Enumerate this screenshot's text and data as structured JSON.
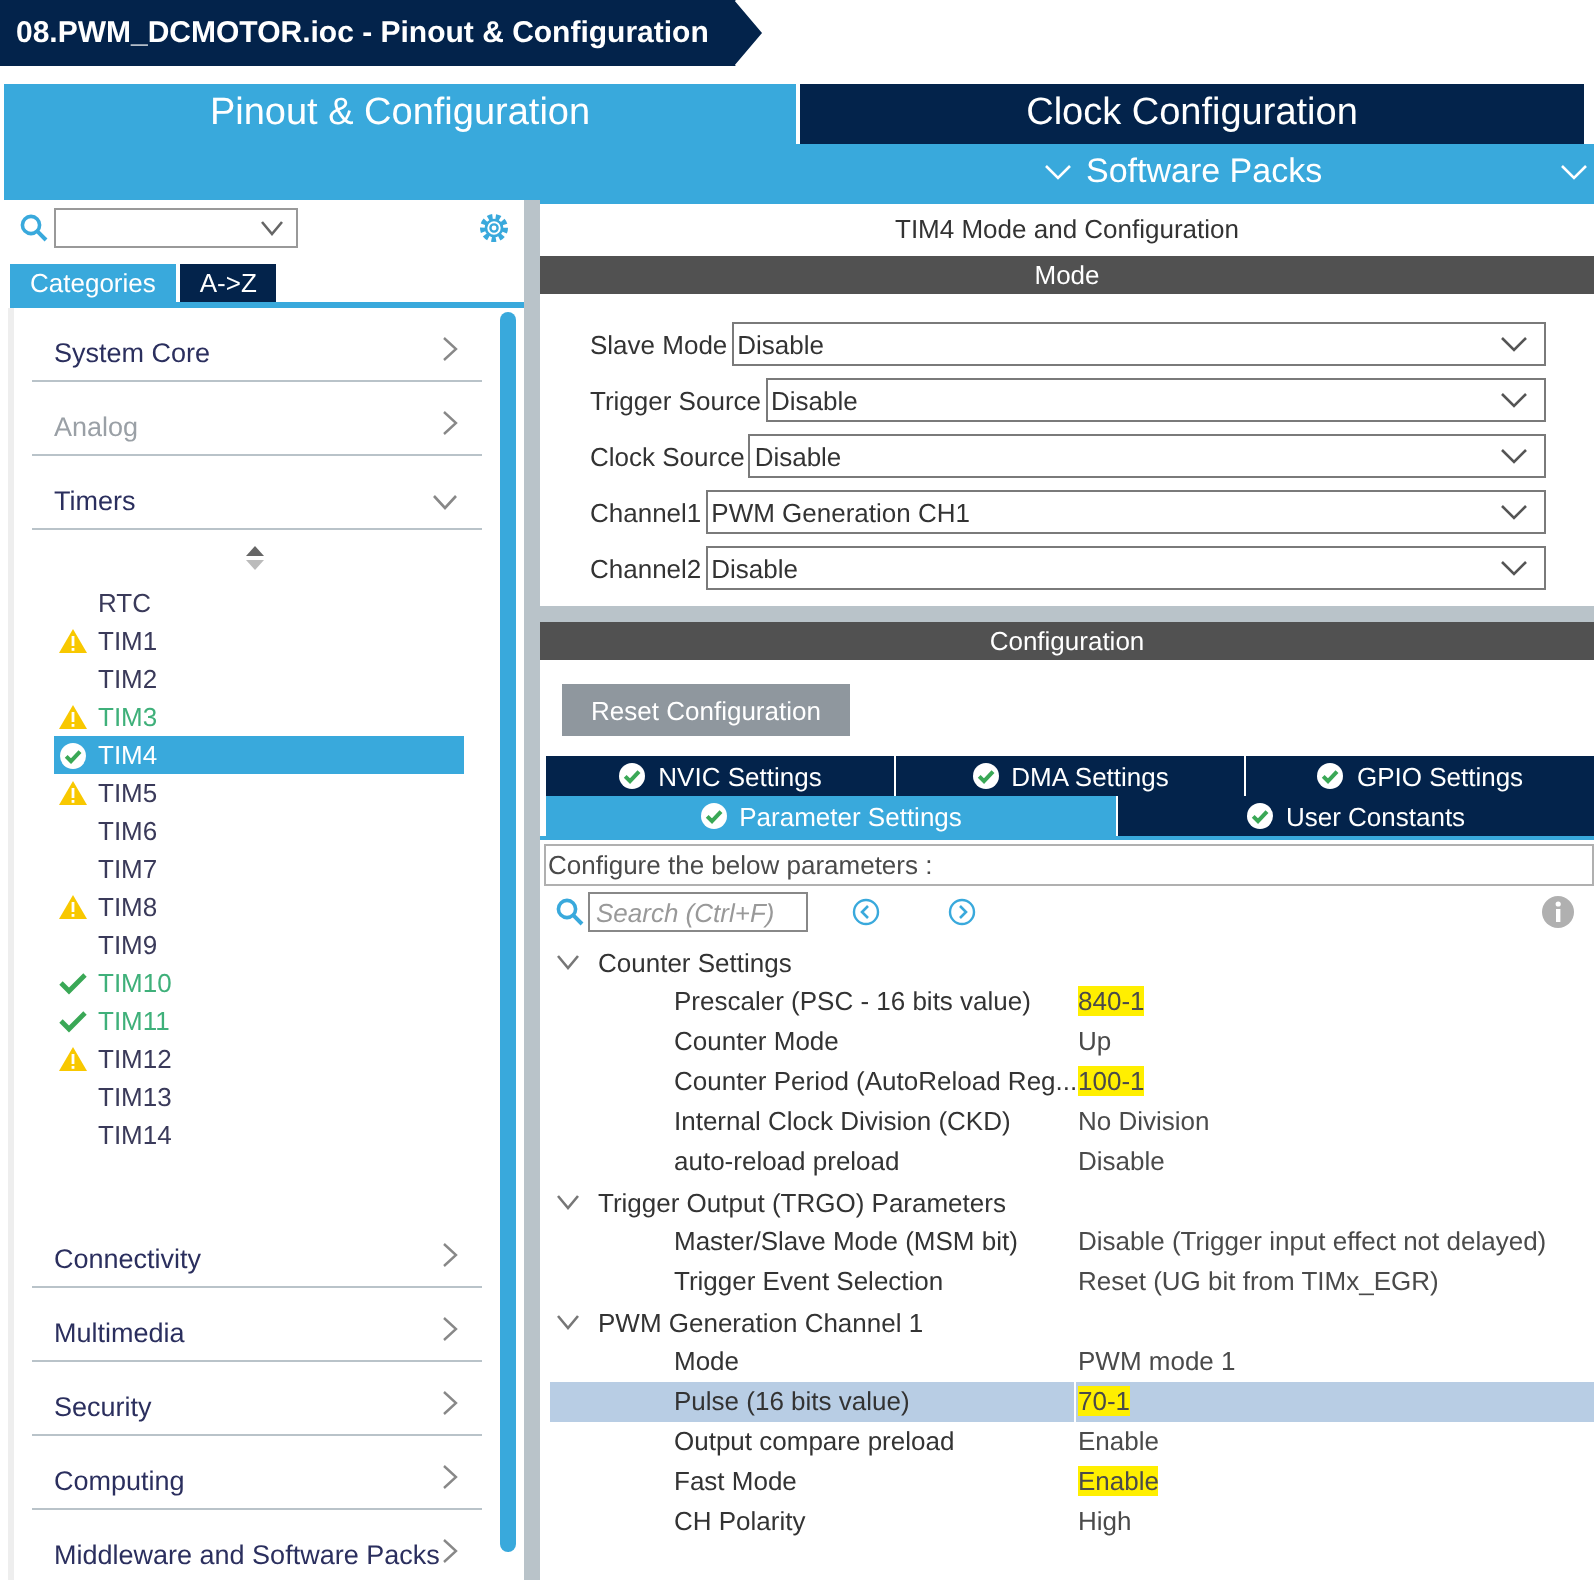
{
  "window": {
    "title": "08.PWM_DCMOTOR.ioc - Pinout & Configuration"
  },
  "main_tabs": [
    {
      "label": "Pinout & Configuration",
      "selected": true
    },
    {
      "label": "Clock Configuration",
      "selected": false
    }
  ],
  "software_packs": {
    "label": "Software Packs"
  },
  "sidebar": {
    "view_tabs": [
      {
        "label": "Categories",
        "selected": true
      },
      {
        "label": "A->Z",
        "selected": false
      }
    ],
    "categories": [
      {
        "label": "System Core",
        "disabled": false,
        "expanded": false
      },
      {
        "label": "Analog",
        "disabled": true,
        "expanded": false
      },
      {
        "label": "Timers",
        "disabled": false,
        "expanded": true,
        "children": [
          {
            "label": "RTC",
            "kind": "plain",
            "configured": false,
            "selected": false
          },
          {
            "label": "TIM1",
            "kind": "warning",
            "configured": false,
            "selected": false
          },
          {
            "label": "TIM2",
            "kind": "plain",
            "configured": false,
            "selected": false
          },
          {
            "label": "TIM3",
            "kind": "warning",
            "configured": true,
            "selected": false
          },
          {
            "label": "TIM4",
            "kind": "check",
            "configured": true,
            "selected": true
          },
          {
            "label": "TIM5",
            "kind": "warning",
            "configured": false,
            "selected": false
          },
          {
            "label": "TIM6",
            "kind": "plain",
            "configured": false,
            "selected": false
          },
          {
            "label": "TIM7",
            "kind": "plain",
            "configured": false,
            "selected": false
          },
          {
            "label": "TIM8",
            "kind": "warning",
            "configured": false,
            "selected": false
          },
          {
            "label": "TIM9",
            "kind": "plain",
            "configured": false,
            "selected": false
          },
          {
            "label": "TIM10",
            "kind": "check",
            "configured": true,
            "selected": false
          },
          {
            "label": "TIM11",
            "kind": "check",
            "configured": true,
            "selected": false
          },
          {
            "label": "TIM12",
            "kind": "warning",
            "configured": false,
            "selected": false
          },
          {
            "label": "TIM13",
            "kind": "plain",
            "configured": false,
            "selected": false
          },
          {
            "label": "TIM14",
            "kind": "plain",
            "configured": false,
            "selected": false
          }
        ]
      },
      {
        "label": "Connectivity",
        "disabled": false,
        "expanded": false
      },
      {
        "label": "Multimedia",
        "disabled": false,
        "expanded": false
      },
      {
        "label": "Security",
        "disabled": false,
        "expanded": false
      },
      {
        "label": "Computing",
        "disabled": false,
        "expanded": false
      },
      {
        "label": "Middleware and Software Packs",
        "disabled": false,
        "expanded": false
      }
    ]
  },
  "panel": {
    "title": "TIM4 Mode and Configuration",
    "mode_header": "Mode",
    "mode_rows": [
      {
        "label": "Slave Mode",
        "value": "Disable"
      },
      {
        "label": "Trigger Source",
        "value": "Disable"
      },
      {
        "label": "Clock Source",
        "value": "Disable"
      },
      {
        "label": "Channel1",
        "value": "PWM Generation CH1"
      },
      {
        "label": "Channel2",
        "value": "Disable"
      }
    ],
    "config_header": "Configuration",
    "reset_button": "Reset Configuration",
    "tab_rows": [
      [
        {
          "label": "NVIC Settings",
          "selected": false
        },
        {
          "label": "DMA Settings",
          "selected": false
        },
        {
          "label": "GPIO Settings",
          "selected": false
        }
      ],
      [
        {
          "label": "Parameter Settings",
          "selected": true
        },
        {
          "label": "User Constants",
          "selected": false
        }
      ]
    ],
    "hint": "Configure the below parameters :",
    "search": {
      "placeholder": "Search (Ctrl+F)"
    },
    "groups": [
      {
        "label": "Counter Settings",
        "expanded": true,
        "children": [
          {
            "name": "Prescaler (PSC - 16 bits value)",
            "value": "840-1",
            "highlighted": true,
            "selected": false
          },
          {
            "name": "Counter Mode",
            "value": "Up",
            "highlighted": false,
            "selected": false
          },
          {
            "name": "Counter Period (AutoReload Reg...",
            "value": "100-1",
            "highlighted": true,
            "selected": false
          },
          {
            "name": "Internal Clock Division (CKD)",
            "value": "No Division",
            "highlighted": false,
            "selected": false
          },
          {
            "name": "auto-reload preload",
            "value": "Disable",
            "highlighted": false,
            "selected": false
          }
        ]
      },
      {
        "label": "Trigger Output (TRGO) Parameters",
        "expanded": true,
        "children": [
          {
            "name": "Master/Slave Mode (MSM bit)",
            "value": "Disable (Trigger input effect not delayed)",
            "highlighted": false,
            "selected": false
          },
          {
            "name": "Trigger Event Selection",
            "value": "Reset (UG bit from TIMx_EGR)",
            "highlighted": false,
            "selected": false
          }
        ]
      },
      {
        "label": "PWM Generation Channel 1",
        "expanded": true,
        "children": [
          {
            "name": "Mode",
            "value": "PWM mode 1",
            "highlighted": false,
            "selected": false
          },
          {
            "name": "Pulse (16 bits value)",
            "value": "70-1",
            "highlighted": true,
            "selected": true
          },
          {
            "name": "Output compare preload",
            "value": "Enable",
            "highlighted": false,
            "selected": false
          },
          {
            "name": "Fast Mode",
            "value": "Enable",
            "highlighted": true,
            "selected": false
          },
          {
            "name": "CH Polarity",
            "value": "High",
            "highlighted": false,
            "selected": false
          }
        ]
      }
    ]
  }
}
